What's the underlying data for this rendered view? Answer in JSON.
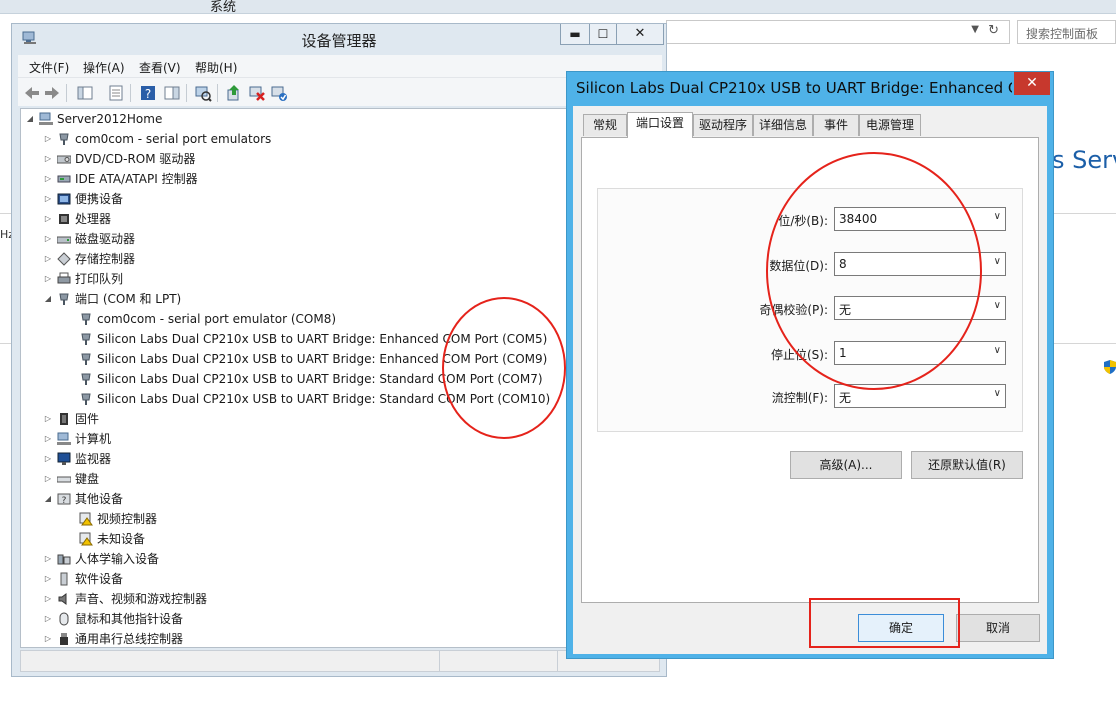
{
  "background": {
    "title": "系统",
    "search_placeholder": "搜索控制面板",
    "brand_fragment": "s Serv",
    "hz_fragment": "Hz"
  },
  "device_manager": {
    "title": "设备管理器",
    "window_buttons": {
      "minimize": "▬",
      "maximize": "☐",
      "close": "✕"
    },
    "menu": [
      "文件(F)",
      "操作(A)",
      "查看(V)",
      "帮助(H)"
    ],
    "tree": {
      "root": "Server2012Home",
      "items": [
        {
          "label": "com0com - serial port emulators",
          "level": 1,
          "expanded": false,
          "icon": "port-icon"
        },
        {
          "label": "DVD/CD-ROM 驱动器",
          "level": 1,
          "expanded": false,
          "icon": "dvd-icon"
        },
        {
          "label": "IDE ATA/ATAPI 控制器",
          "level": 1,
          "expanded": false,
          "icon": "ide-icon"
        },
        {
          "label": "便携设备",
          "level": 1,
          "expanded": false,
          "icon": "portable-icon"
        },
        {
          "label": "处理器",
          "level": 1,
          "expanded": false,
          "icon": "cpu-icon"
        },
        {
          "label": "磁盘驱动器",
          "level": 1,
          "expanded": false,
          "icon": "disk-icon"
        },
        {
          "label": "存储控制器",
          "level": 1,
          "expanded": false,
          "icon": "storage-icon"
        },
        {
          "label": "打印队列",
          "level": 1,
          "expanded": false,
          "icon": "printer-icon"
        },
        {
          "label": "端口 (COM 和 LPT)",
          "level": 1,
          "expanded": true,
          "icon": "port-icon"
        },
        {
          "label": "com0com - serial port emulator (COM8)",
          "level": 2,
          "icon": "port-icon"
        },
        {
          "label": "Silicon Labs Dual CP210x USB to UART Bridge: Enhanced COM Port (COM5)",
          "level": 2,
          "icon": "port-icon"
        },
        {
          "label": "Silicon Labs Dual CP210x USB to UART Bridge: Enhanced COM Port (COM9)",
          "level": 2,
          "icon": "port-icon"
        },
        {
          "label": "Silicon Labs Dual CP210x USB to UART Bridge: Standard COM Port (COM7)",
          "level": 2,
          "icon": "port-icon"
        },
        {
          "label": "Silicon Labs Dual CP210x USB to UART Bridge: Standard COM Port (COM10)",
          "level": 2,
          "icon": "port-icon"
        },
        {
          "label": "固件",
          "level": 1,
          "expanded": false,
          "icon": "firmware-icon"
        },
        {
          "label": "计算机",
          "level": 1,
          "expanded": false,
          "icon": "computer-icon"
        },
        {
          "label": "监视器",
          "level": 1,
          "expanded": false,
          "icon": "monitor-icon"
        },
        {
          "label": "键盘",
          "level": 1,
          "expanded": false,
          "icon": "keyboard-icon"
        },
        {
          "label": "其他设备",
          "level": 1,
          "expanded": true,
          "icon": "unknown-device-icon"
        },
        {
          "label": "视频控制器",
          "level": 2,
          "icon": "warning-device-icon"
        },
        {
          "label": "未知设备",
          "level": 2,
          "icon": "warning-device-icon"
        },
        {
          "label": "人体学输入设备",
          "level": 1,
          "expanded": false,
          "icon": "hid-icon"
        },
        {
          "label": "软件设备",
          "level": 1,
          "expanded": false,
          "icon": "software-device-icon"
        },
        {
          "label": "声音、视频和游戏控制器",
          "level": 1,
          "expanded": false,
          "icon": "speaker-icon"
        },
        {
          "label": "鼠标和其他指针设备",
          "level": 1,
          "expanded": false,
          "icon": "mouse-icon"
        },
        {
          "label": "通用串行总线控制器",
          "level": 1,
          "expanded": false,
          "icon": "usb-icon"
        }
      ]
    }
  },
  "dialog": {
    "title": "Silicon Labs Dual CP210x USB to UART Bridge: Enhanced C...",
    "close": "✕",
    "tabs": [
      "常规",
      "端口设置",
      "驱动程序",
      "详细信息",
      "事件",
      "电源管理"
    ],
    "active_tab": "端口设置",
    "fields": [
      {
        "label": "位/秒(B):",
        "value": "38400"
      },
      {
        "label": "数据位(D):",
        "value": "8"
      },
      {
        "label": "奇偶校验(P):",
        "value": "无"
      },
      {
        "label": "停止位(S):",
        "value": "1"
      },
      {
        "label": "流控制(F):",
        "value": "无"
      }
    ],
    "advanced_button": "高级(A)...",
    "restore_button": "还原默认值(R)",
    "ok_button": "确定",
    "cancel_button": "取消"
  },
  "colors": {
    "dialog_frame": "#4fb2e8",
    "close_red": "#c7382d",
    "annotation_red": "#e5231b"
  }
}
